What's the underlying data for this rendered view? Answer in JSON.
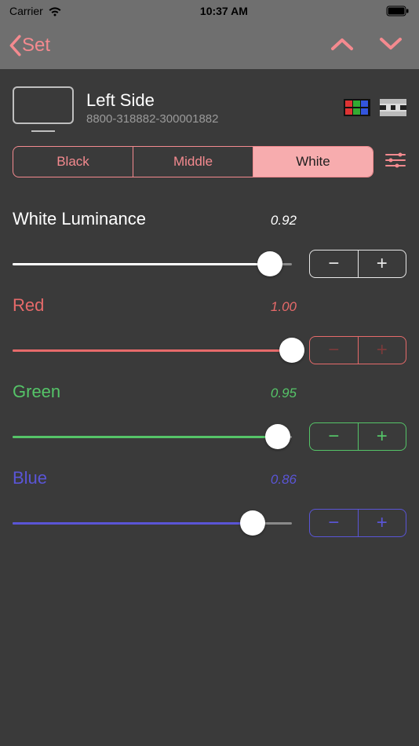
{
  "status": {
    "carrier": "Carrier",
    "time": "10:37 AM"
  },
  "nav": {
    "back_label": "Set"
  },
  "device": {
    "title": "Left Side",
    "serial": "8800-318882-300001882"
  },
  "tabs": {
    "items": [
      "Black",
      "Middle",
      "White"
    ],
    "selected": 2
  },
  "params": [
    {
      "key": "luminance",
      "label": "White Luminance",
      "value": 0.92,
      "display": "0.92",
      "color": "white"
    },
    {
      "key": "red",
      "label": "Red",
      "value": 1.0,
      "display": "1.00",
      "color": "red"
    },
    {
      "key": "green",
      "label": "Green",
      "value": 0.95,
      "display": "0.95",
      "color": "green"
    },
    {
      "key": "blue",
      "label": "Blue",
      "value": 0.86,
      "display": "0.86",
      "color": "blue"
    }
  ],
  "stepper": {
    "minus": "−",
    "plus": "+"
  }
}
